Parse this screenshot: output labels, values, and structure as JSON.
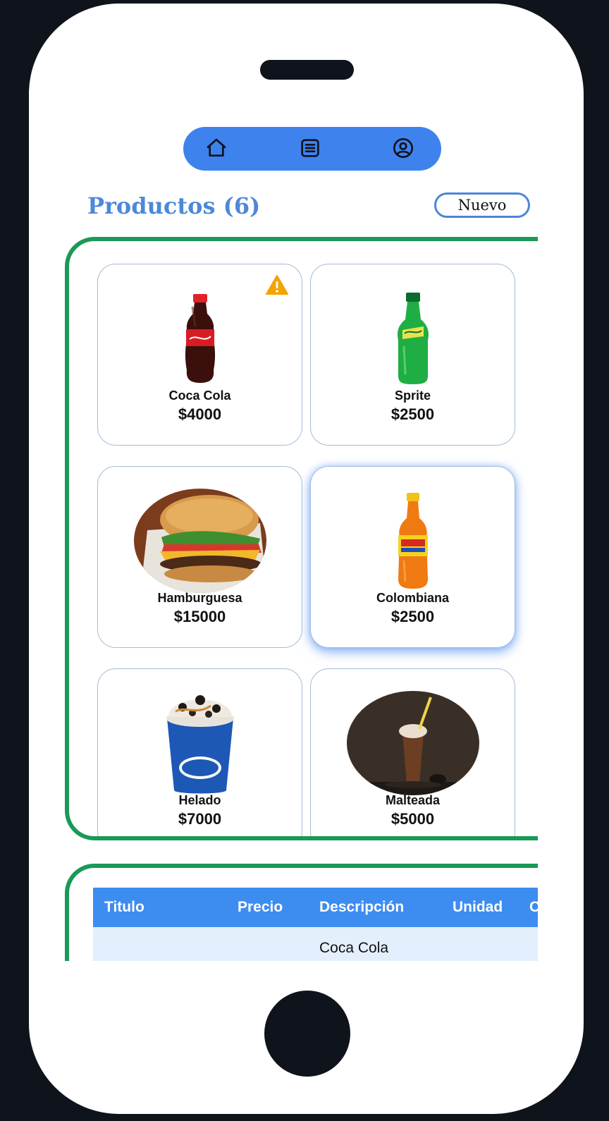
{
  "nav": {
    "items": [
      {
        "icon": "home-icon"
      },
      {
        "icon": "list-icon"
      },
      {
        "icon": "user-circle-icon"
      }
    ],
    "color": "#3e82ee"
  },
  "header": {
    "title": "Productos (6)",
    "new_button_label": "Nuevo"
  },
  "products": [
    {
      "name": "Coca Cola",
      "price": "$4000",
      "warning": true
    },
    {
      "name": "Sprite",
      "price": "$2500",
      "warning": false
    },
    {
      "name": "Hamburguesa",
      "price": "$15000",
      "warning": false
    },
    {
      "name": "Colombiana",
      "price": "$2500",
      "warning": false,
      "selected": true
    },
    {
      "name": "Helado",
      "price": "$7000",
      "warning": false
    },
    {
      "name": "Malteada",
      "price": "$5000",
      "warning": false
    }
  ],
  "table": {
    "columns": [
      "Titulo",
      "Precio",
      "Descripción",
      "Unidad",
      "C"
    ],
    "rows": [
      {
        "descripcion": "Coca Cola"
      }
    ]
  },
  "colors": {
    "frame_green": "#1a9957",
    "title_blue": "#4d88d9",
    "table_header": "#3d8cf0",
    "warning": "#f4a300"
  }
}
